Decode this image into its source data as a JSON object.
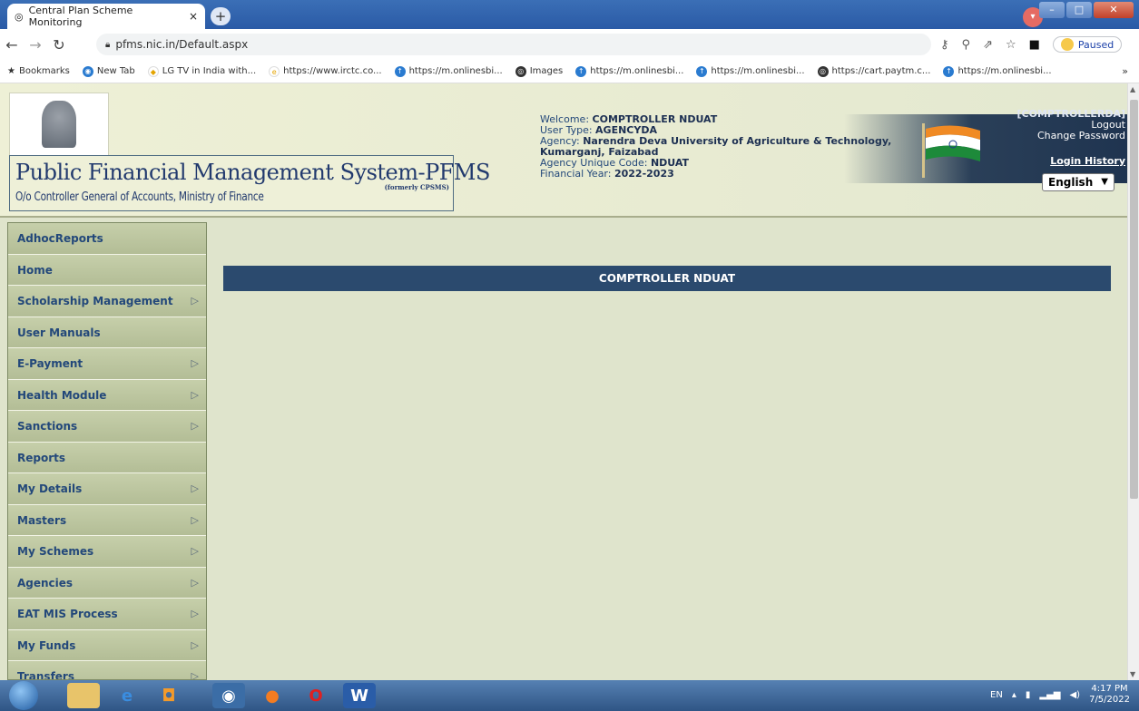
{
  "browser": {
    "tab_title": "Central Plan Scheme Monitoring",
    "tab_close": "×",
    "new_tab": "+",
    "url": "pfms.nic.in/Default.aspx",
    "paused_label": "Paused",
    "bookmarks_label": "Bookmarks",
    "bookmarks": [
      "New Tab",
      "LG TV in India with...",
      "https://www.irctc.co...",
      "https://m.onlinesbi...",
      "Images",
      "https://m.onlinesbi...",
      "https://m.onlinesbi...",
      "https://cart.paytm.c...",
      "https://m.onlinesbi..."
    ],
    "more": "»"
  },
  "header": {
    "title": "Public Financial Management System-PFMS",
    "formerly": "(formerly CPSMS)",
    "subtitle": "O/o Controller General of Accounts, Ministry of Finance",
    "welcome_label": "Welcome:",
    "welcome_value": "COMPTROLLER NDUAT",
    "user_type_label": "User Type:",
    "user_type_value": "AGENCYDA",
    "agency_label": "Agency:",
    "agency_value_1": "Narendra Deva University of Agriculture & Technology,",
    "agency_value_2": "Kumarganj, Faizabad",
    "agency_code_label": "Agency Unique Code:",
    "agency_code_value": "NDUAT",
    "fy_label": "Financial Year:",
    "fy_value": "2022-2023",
    "username": "[COMPTROLLERDA]",
    "logout": "Logout",
    "change_password": "Change Password",
    "login_history": "Login History",
    "language": "English"
  },
  "sidebar": {
    "items": [
      {
        "label": "AdhocReports",
        "sub": false
      },
      {
        "label": "Home",
        "sub": false
      },
      {
        "label": "Scholarship Management",
        "sub": true
      },
      {
        "label": "User Manuals",
        "sub": false
      },
      {
        "label": "E-Payment",
        "sub": true
      },
      {
        "label": "Health Module",
        "sub": true
      },
      {
        "label": "Sanctions",
        "sub": true
      },
      {
        "label": "Reports",
        "sub": false
      },
      {
        "label": "My Details",
        "sub": true
      },
      {
        "label": "Masters",
        "sub": true
      },
      {
        "label": "My Schemes",
        "sub": true
      },
      {
        "label": "Agencies",
        "sub": true
      },
      {
        "label": "EAT MIS Process",
        "sub": true
      },
      {
        "label": "My Funds",
        "sub": true
      },
      {
        "label": "Transfers",
        "sub": true
      }
    ]
  },
  "main": {
    "banner": "COMPTROLLER NDUAT"
  },
  "taskbar": {
    "lang": "EN",
    "time": "4:17 PM",
    "date": "7/5/2022"
  }
}
